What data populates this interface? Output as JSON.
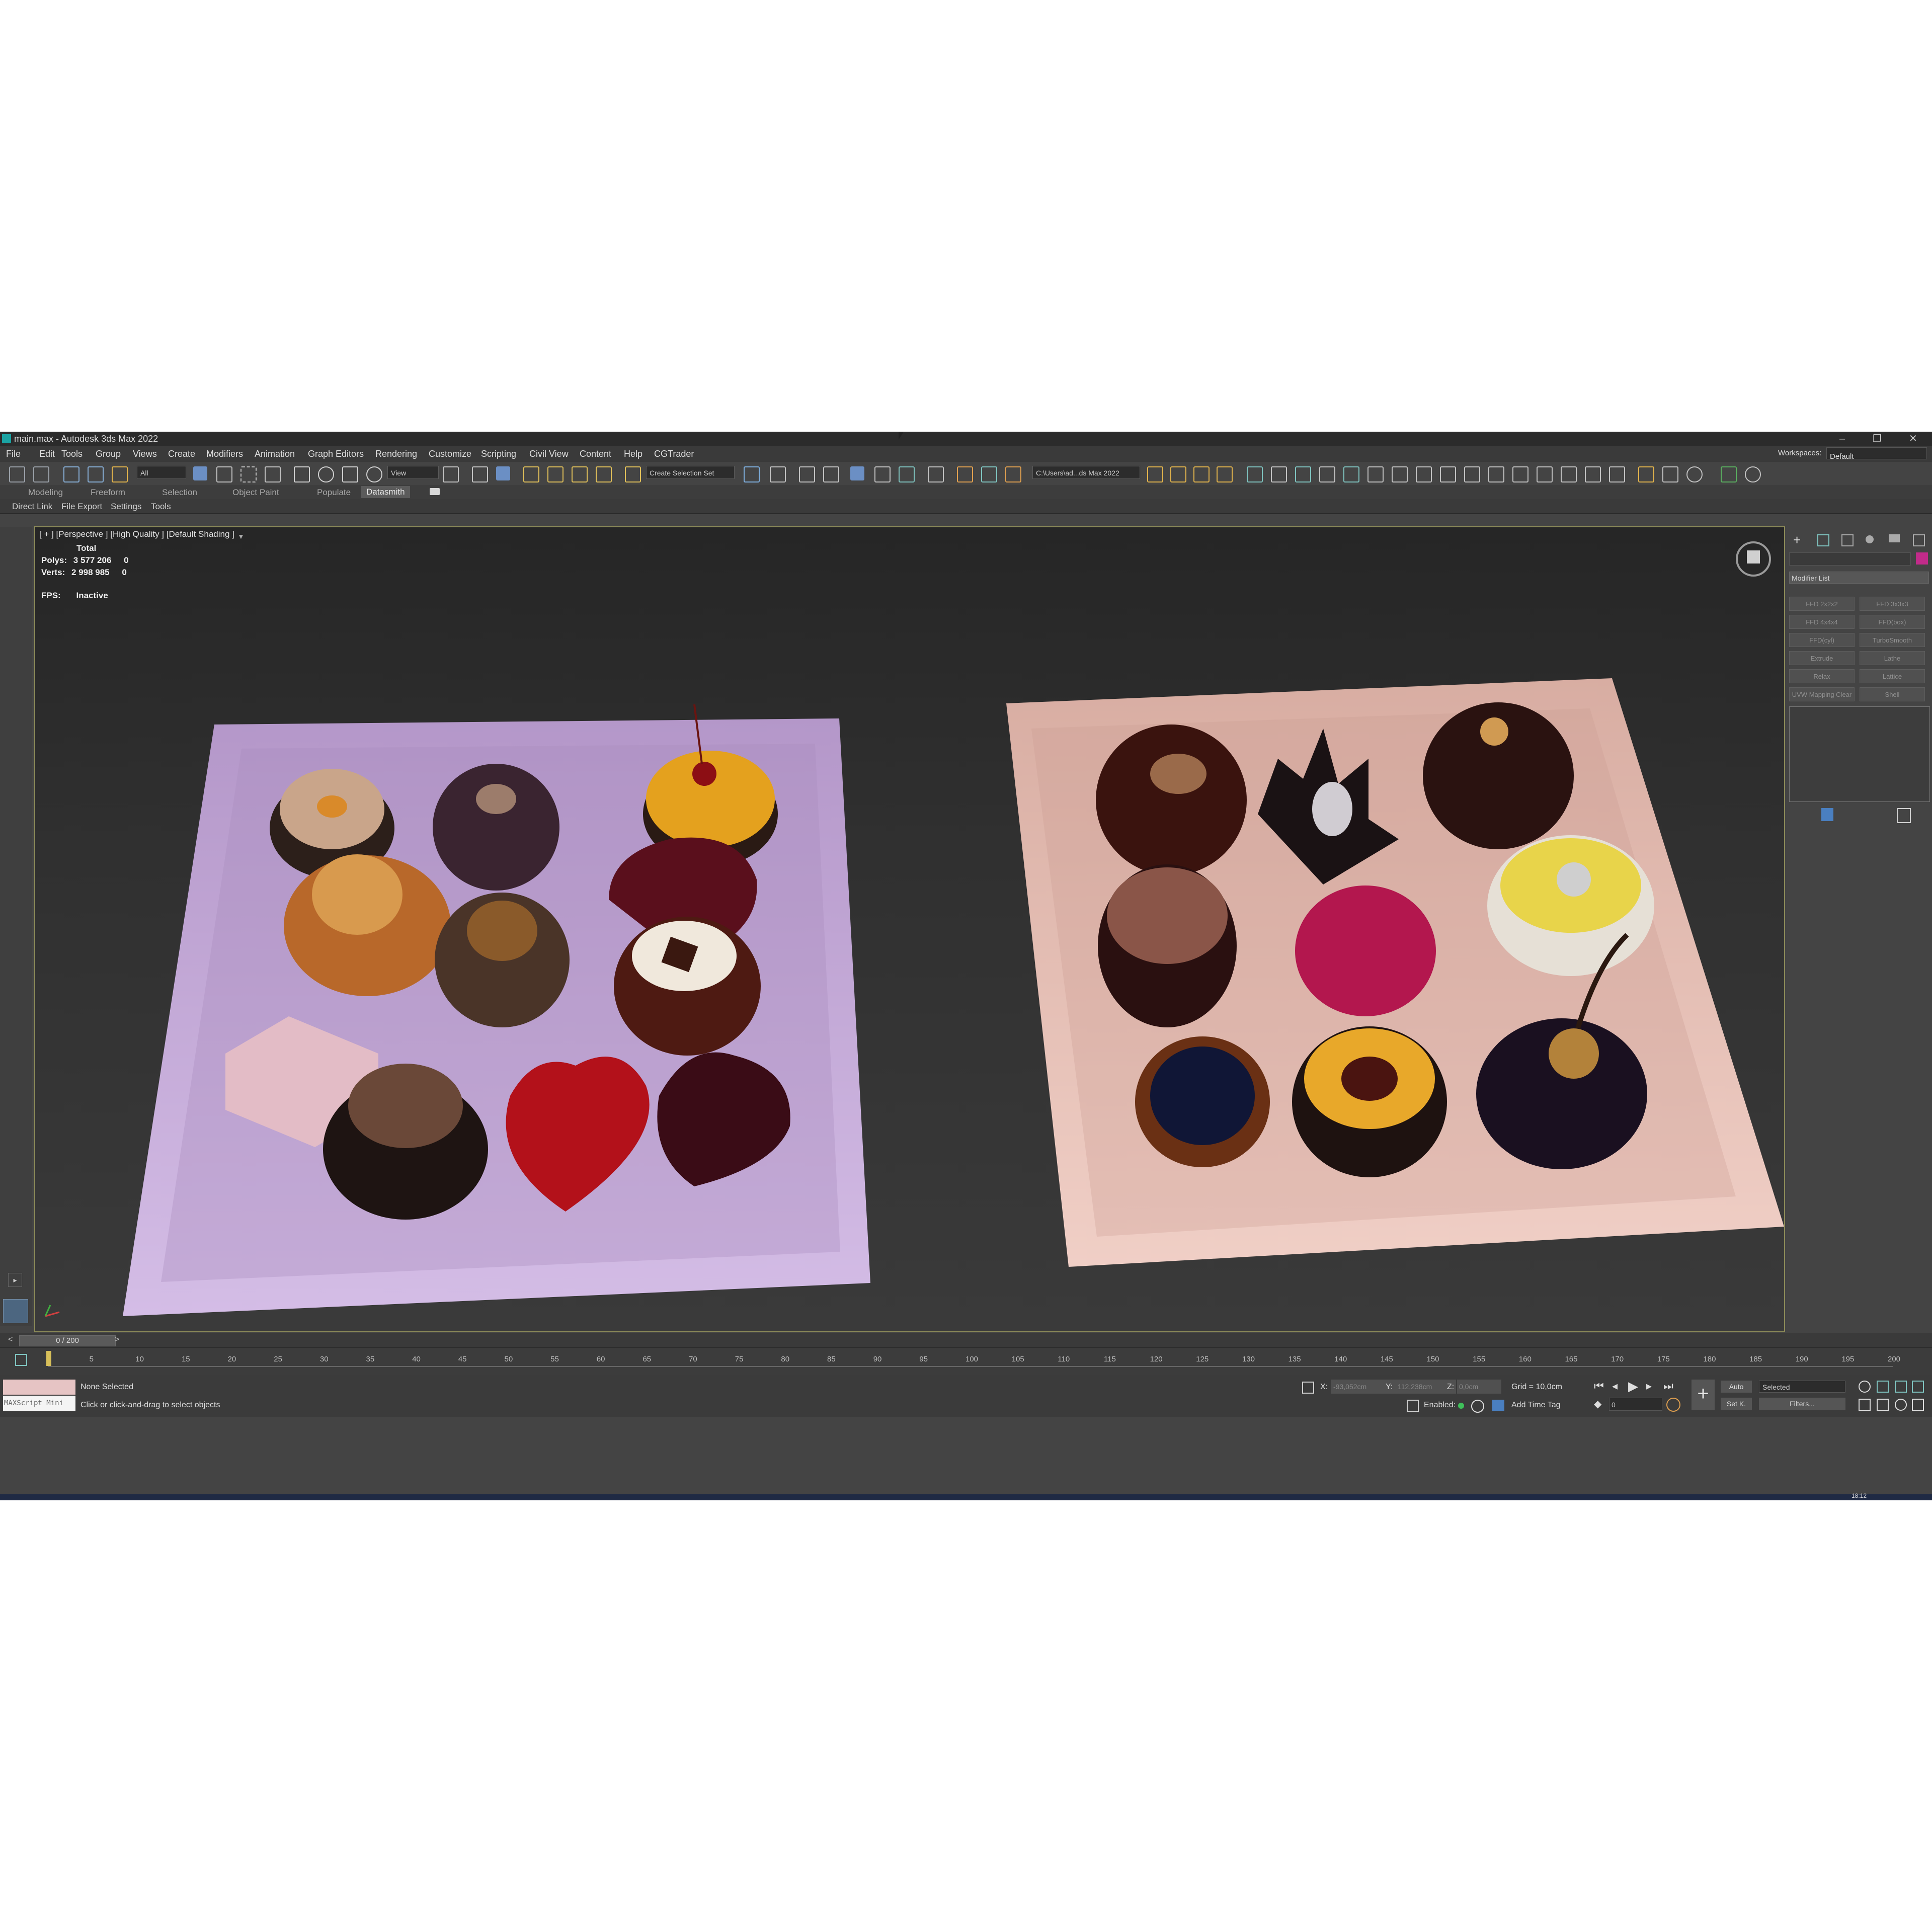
{
  "window": {
    "title": "main.max - Autodesk 3ds Max 2022",
    "min": "–",
    "max": "❐",
    "close": "✕"
  },
  "menu": [
    "File",
    "Edit",
    "Tools",
    "Group",
    "Views",
    "Create",
    "Modifiers",
    "Animation",
    "Graph Editors",
    "Rendering",
    "Customize",
    "Scripting",
    "Civil View",
    "Content",
    "Help",
    "CGTrader"
  ],
  "workspaces": {
    "label": "Workspaces:",
    "value": "Default"
  },
  "toolbar": {
    "filter": "All",
    "view": "View",
    "selection_set": "Create Selection Set",
    "path": "C:\\Users\\ad...ds Max 2022"
  },
  "ribbon_tabs": [
    "Modeling",
    "Freeform",
    "Selection",
    "Object Paint",
    "Populate",
    "Datasmith"
  ],
  "ribbon_sub": [
    "Direct Link",
    "File Export",
    "Settings",
    "Tools"
  ],
  "viewport": {
    "label": "[ + ] [Perspective ] [High Quality ] [Default Shading ]",
    "stats_header": "Total",
    "polys_label": "Polys:",
    "polys_value": "3 577 206",
    "polys_sel": "0",
    "verts_label": "Verts:",
    "verts_value": "2 998 985",
    "verts_sel": "0",
    "fps_label": "FPS:",
    "fps_value": "Inactive"
  },
  "command_panel": {
    "modifier_list": "Modifier List",
    "buttons": [
      "FFD 2x2x2",
      "FFD 3x3x3",
      "FFD 4x4x4",
      "FFD(box)",
      "FFD(cyl)",
      "TurboSmooth",
      "Extrude",
      "Lathe",
      "Relax",
      "Lattice",
      "UVW Mapping Clear",
      "Shell"
    ]
  },
  "timeline": {
    "frame": "0 / 200",
    "ticks": [
      "5",
      "10",
      "15",
      "20",
      "25",
      "30",
      "35",
      "40",
      "45",
      "50",
      "55",
      "60",
      "65",
      "70",
      "75",
      "80",
      "85",
      "90",
      "95",
      "100",
      "105",
      "110",
      "115",
      "120",
      "125",
      "130",
      "135",
      "140",
      "145",
      "150",
      "155",
      "160",
      "165",
      "170",
      "175",
      "180",
      "185",
      "190",
      "195",
      "200"
    ]
  },
  "status": {
    "maxscript": "MAXScript Mini",
    "selection": "None Selected",
    "hint": "Click or click-and-drag to select objects",
    "x_label": "X:",
    "x_value": "-93,052cm",
    "y_label": "Y:",
    "y_value": "112,238cm",
    "z_label": "Z:",
    "z_value": "0,0cm",
    "grid": "Grid = 10,0cm",
    "enabled": "Enabled:",
    "add_time_tag": "Add Time Tag",
    "auto": "Auto",
    "set_key": "Set K.",
    "selected": "Selected",
    "filters": "Filters...",
    "frame_field": "0"
  },
  "taskbar": {
    "clock": "18:12"
  },
  "colors": {
    "plate_left": "#c3a6d8",
    "plate_right": "#e5c0b6",
    "viewport_border": "#8b8a58",
    "accent_blue": "#3a6fb5"
  }
}
